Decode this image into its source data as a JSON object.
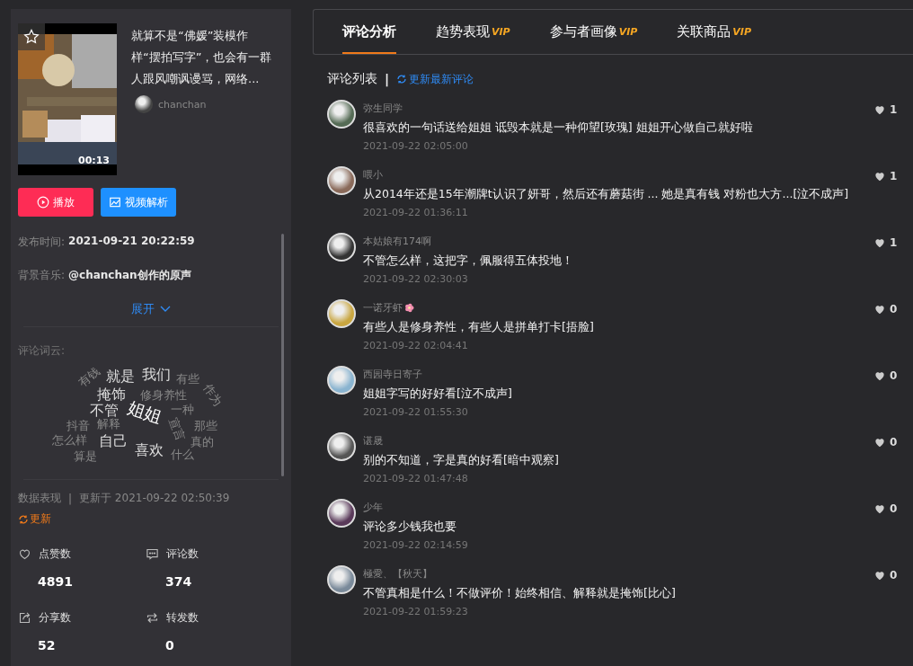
{
  "video": {
    "duration": "00:13",
    "title": "就算不是“佛媛”装模作样“摆拍写字”，也会有一群人跟风嘲讽谩骂，网络...",
    "author": "chanchan",
    "favorited": false
  },
  "actions": [
    {
      "kind": "play",
      "label": "播放"
    },
    {
      "kind": "analyze",
      "label": "视频解析"
    }
  ],
  "info": [
    {
      "label": "发布时间:",
      "value": "2021-09-21 20:22:59"
    },
    {
      "label": "背景音乐:",
      "value": "@chanchan创作的原声"
    }
  ],
  "expand": {
    "label": "展开",
    "expanded": false
  },
  "word_cloud": {
    "label": "评论词云:",
    "words": [
      {
        "text": "有钱",
        "kind": "minor"
      },
      {
        "text": "就是",
        "kind": "major"
      },
      {
        "text": "我们",
        "kind": "major"
      },
      {
        "text": "有些",
        "kind": "minor"
      },
      {
        "text": "掩饰",
        "kind": "major"
      },
      {
        "text": "修身养性",
        "kind": "minor"
      },
      {
        "text": "作为",
        "kind": "minor"
      },
      {
        "text": "不管",
        "kind": "major"
      },
      {
        "text": "姐姐",
        "kind": "hero"
      },
      {
        "text": "一种",
        "kind": "minor"
      },
      {
        "text": "抖音",
        "kind": "minor"
      },
      {
        "text": "解释",
        "kind": "minor"
      },
      {
        "text": "宣言",
        "kind": "minor"
      },
      {
        "text": "那些",
        "kind": "minor"
      },
      {
        "text": "怎么样",
        "kind": "minor"
      },
      {
        "text": "自己",
        "kind": "major"
      },
      {
        "text": "真的",
        "kind": "minor"
      },
      {
        "text": "算是",
        "kind": "minor"
      },
      {
        "text": "喜欢",
        "kind": "major"
      },
      {
        "text": "什么",
        "kind": "minor"
      }
    ]
  },
  "stats_header": {
    "title": "数据表现",
    "separator": "|",
    "updated": "更新于 2021-09-22 02:50:39",
    "refresh": "更新"
  },
  "stats": [
    {
      "kind": "likes",
      "label": "点赞数",
      "value": "4891"
    },
    {
      "kind": "comments",
      "label": "评论数",
      "value": "374"
    },
    {
      "kind": "shares",
      "label": "分享数",
      "value": "52"
    },
    {
      "kind": "reposts",
      "label": "转发数",
      "value": "0"
    }
  ],
  "tabs": [
    {
      "label": "评论分析",
      "selected": true
    },
    {
      "label": "趋势表现",
      "badge": "VIP",
      "selected": false
    },
    {
      "label": "参与者画像",
      "badge": "VIP",
      "selected": false
    },
    {
      "label": "关联商品",
      "badge": "VIP",
      "selected": false
    }
  ],
  "comment_list": {
    "title": "评论列表",
    "separator": "|",
    "refresh": "更新最新评论"
  },
  "comments": [
    {
      "user": "弥生同学",
      "text": "很喜欢的一句话送给姐姐 诋毁本就是一种仰望[玫瑰] 姐姐开心做自己就好啦",
      "time": "2021-09-22 02:05:00",
      "likes": "1"
    },
    {
      "user": "喂小",
      "text": "从2014年还是15年潮牌t认识了妍哥，然后还有蘑菇街 ... 她是真有钱 对粉也大方...[泣不成声]",
      "time": "2021-09-22 01:36:11",
      "likes": "1"
    },
    {
      "user": "本姑娘有174啊",
      "text": "不管怎么样，这把字，佩服得五体投地！",
      "time": "2021-09-22 02:30:03",
      "likes": "1"
    },
    {
      "user": "一诺牙虾",
      "flower": true,
      "text": "有些人是修身养性，有些人是拼单打卡[捂脸]",
      "time": "2021-09-22 02:04:41",
      "likes": "0"
    },
    {
      "user": "西园寺日寄子",
      "text": "姐姐字写的好好看[泣不成声]",
      "time": "2021-09-22 01:55:30",
      "likes": "0"
    },
    {
      "user": "谌晟",
      "text": "别的不知道，字是真的好看[暗中观察]",
      "time": "2021-09-22 01:47:48",
      "likes": "0"
    },
    {
      "user": "少年",
      "text": "评论多少钱我也要",
      "time": "2021-09-22 02:14:59",
      "likes": "0"
    },
    {
      "user": "極愛、【秋天】",
      "text": "不管真相是什么！不做评价！始终相信、解释就是掩饰[比心]",
      "time": "2021-09-22 01:59:23",
      "likes": "0"
    }
  ]
}
